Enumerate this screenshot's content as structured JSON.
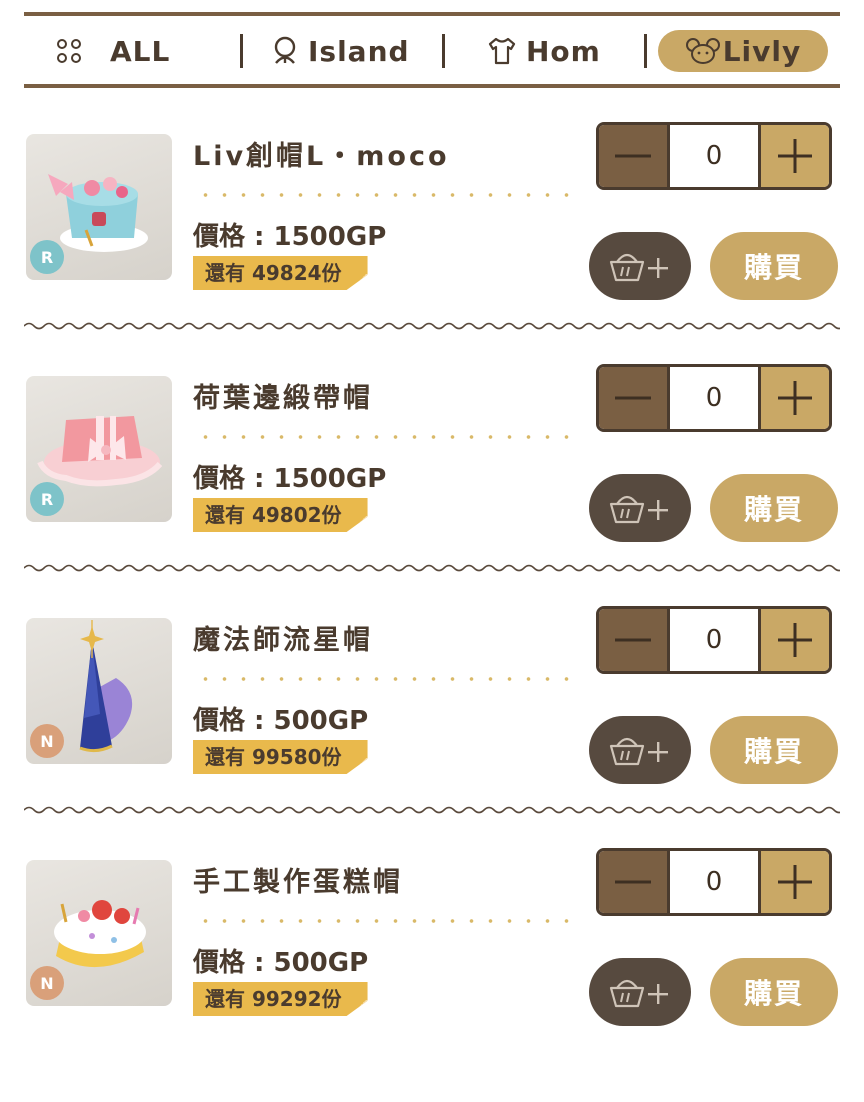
{
  "tabs": [
    {
      "label": "ALL",
      "icon": "grid-dots-icon"
    },
    {
      "label": "Island",
      "icon": "palm-tree-icon"
    },
    {
      "label": "Hom",
      "icon": "shirt-icon"
    },
    {
      "label": "Livly",
      "icon": "livly-face-icon",
      "active": true
    }
  ],
  "items": [
    {
      "name": "Liv創帽L・moco",
      "price": "價格 : 1500GP",
      "stock": "還有 49824份",
      "rarity": "R",
      "quantity": "0",
      "buy_label": "購買",
      "image": "pastel-top-hat-image"
    },
    {
      "name": "荷葉邊緞帶帽",
      "price": "價格 : 1500GP",
      "stock": "還有 49802份",
      "rarity": "R",
      "quantity": "0",
      "buy_label": "購買",
      "image": "pink-ribbon-hat-image"
    },
    {
      "name": "魔法師流星帽",
      "price": "價格 : 500GP",
      "stock": "還有 99580份",
      "rarity": "N",
      "quantity": "0",
      "buy_label": "購買",
      "image": "wizard-star-hat-image"
    },
    {
      "name": "手工製作蛋糕帽",
      "price": "價格 : 500GP",
      "stock": "還有 99292份",
      "rarity": "N",
      "quantity": "0",
      "buy_label": "購買",
      "image": "cake-hat-image"
    }
  ],
  "colors": {
    "brown_dark": "#4a3b2e",
    "brown_mid": "#7a5f43",
    "gold": "#c9a866",
    "stock_tag": "#e9b94c",
    "rarity_R": "#7ec3c9",
    "rarity_N": "#d9a07a",
    "cart_button": "#574a3f"
  }
}
